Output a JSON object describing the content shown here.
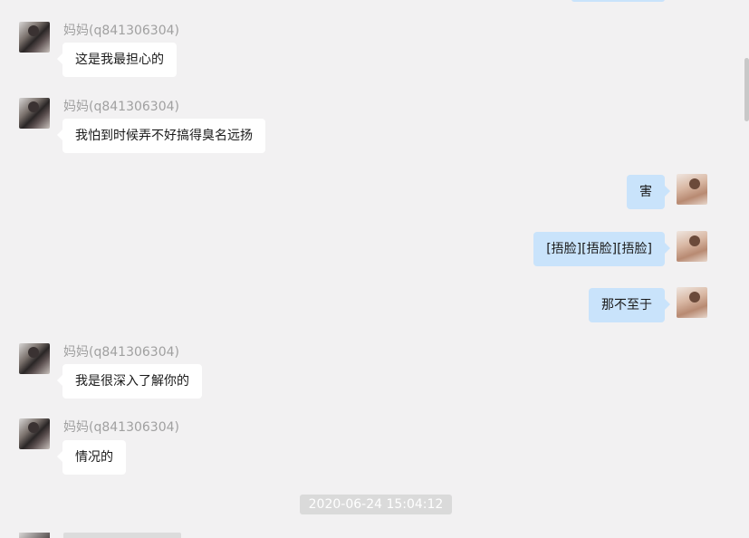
{
  "messages": [
    {
      "sender": "妈妈(q841306304)",
      "text": "这是我最担心的"
    },
    {
      "sender": "妈妈(q841306304)",
      "text": "我怕到时候弄不好搞得臭名远扬"
    },
    {
      "text": "害"
    },
    {
      "text": "[捂脸][捂脸][捂脸]"
    },
    {
      "text": "那不至于"
    },
    {
      "sender": "妈妈(q841306304)",
      "text": "我是很深入了解你的"
    },
    {
      "sender": "妈妈(q841306304)",
      "text": "情况的"
    }
  ],
  "timestamp": "2020-06-24 15:04:12",
  "colors": {
    "background": "#f2f1f2",
    "incoming_bubble": "#ffffff",
    "outgoing_bubble": "#c9e3fb",
    "sender_name": "#a0a0a0",
    "timestamp_bg": "#dadada"
  }
}
